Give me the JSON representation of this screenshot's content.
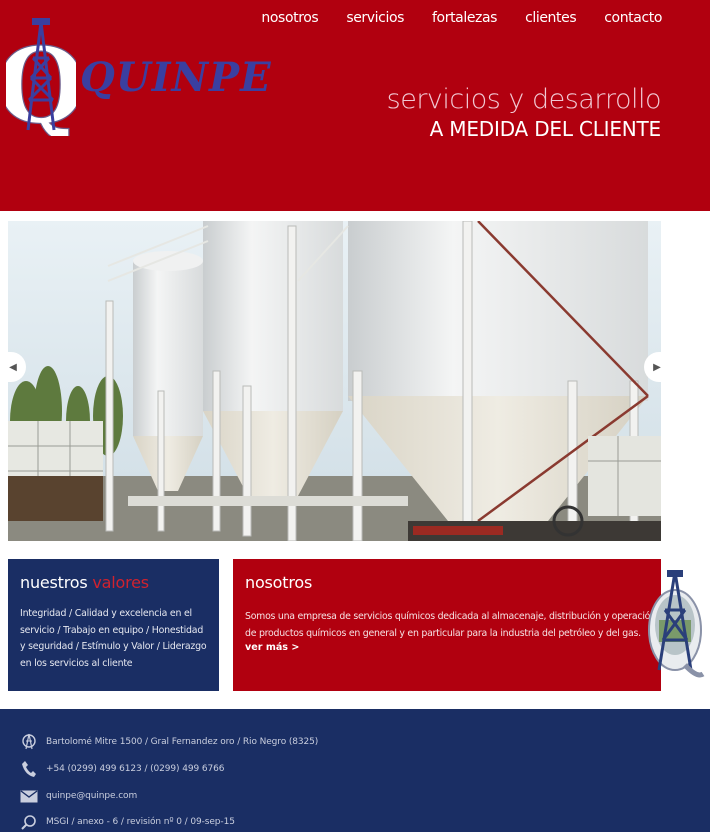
{
  "header": {
    "brand": "QUINPE",
    "logo_letter": "Q",
    "nav": [
      "nosotros",
      "servicios",
      "fortalezas",
      "clientes",
      "contacto"
    ],
    "tagline_1": "servicios y desarrollo",
    "tagline_2": "A MEDIDA DEL CLIENTE"
  },
  "slider": {
    "prev_icon": "chevron-left-icon",
    "next_icon": "chevron-right-icon"
  },
  "values": {
    "title_main": "nuestros",
    "title_accent": "valores",
    "text": "Integridad / Calidad y excelencia en el servicio / Trabajo en equipo / Honestidad y seguridad / Estímulo y Valor / Liderazgo en los servicios al cliente"
  },
  "about": {
    "title": "nosotros",
    "text": "Somos una empresa de servicios químicos dedicada al almacenaje, distribución y operación de productos químicos en general y en particular para la industria del petróleo y del gas.",
    "link": "ver más >"
  },
  "footer": {
    "address": "Bartolomé Mitre 1500 / Gral Fernandez oro / Rio Negro (8325)",
    "phone": "+54 (0299) 499 6123 / (0299) 499 6766",
    "email": "quinpe@quinpe.com",
    "doc": "MSGI / anexo - 6 / revisión nº 0 / 09-sep-15"
  },
  "colors": {
    "brand_red": "#b1000f",
    "brand_navy": "#1a2e64",
    "accent_red": "#d0222e"
  }
}
